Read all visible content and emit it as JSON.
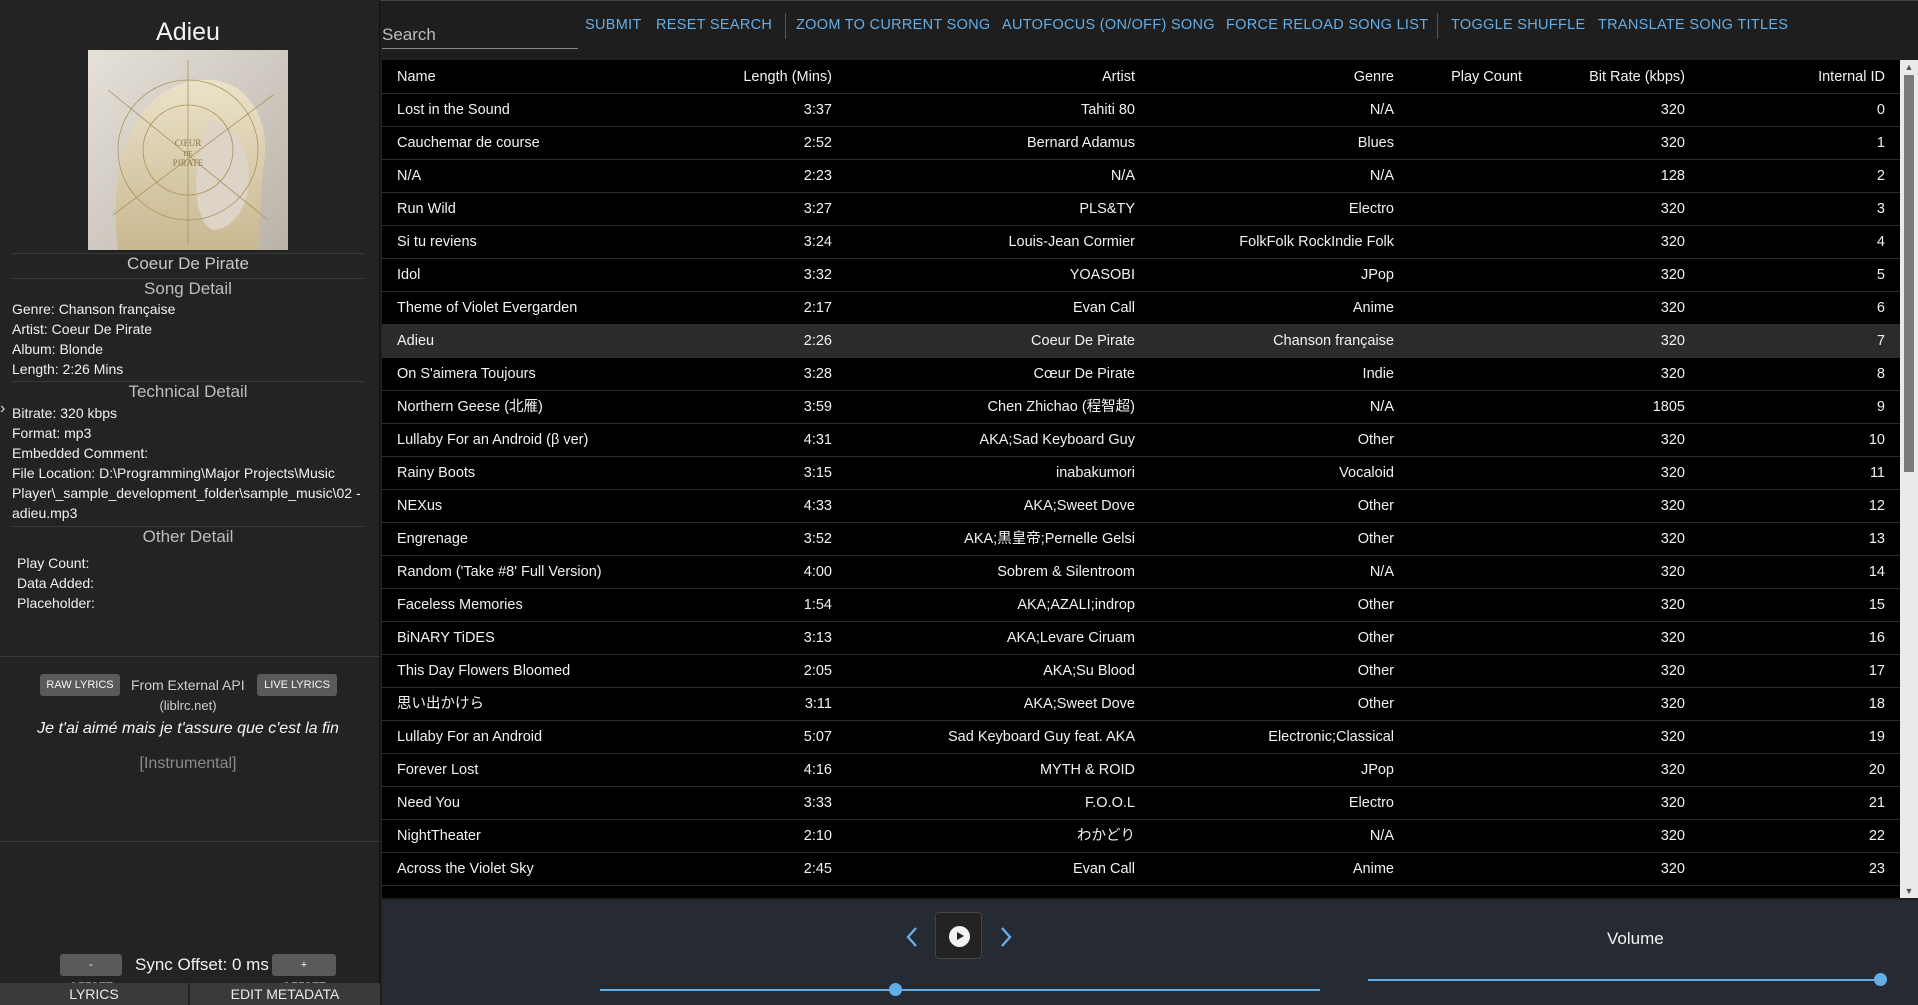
{
  "now_playing": {
    "title": "Adieu",
    "artist": "Coeur De Pirate",
    "cover_text": [
      "CŒUR",
      "DE",
      "PIRATE"
    ]
  },
  "song_detail": {
    "heading": "Song Detail",
    "genre": "Genre: Chanson française",
    "artist": "Artist: Coeur De Pirate",
    "album": "Album: Blonde",
    "length": "Length: 2:26 Mins"
  },
  "technical_detail": {
    "heading": "Technical Detail",
    "bitrate": "Bitrate: 320 kbps",
    "format": "Format: mp3",
    "comment": "Embedded Comment:",
    "file_location": "File Location: D:\\Programming\\Major Projects\\Music Player\\_sample_development_folder\\sample_music\\02 - adieu.mp3"
  },
  "other_detail": {
    "heading": "Other Detail",
    "play_count": "Play Count:",
    "date_added": "Data Added:",
    "placeholder": "Placeholder:"
  },
  "lyrics": {
    "raw_label": "RAW LYRICS",
    "live_label": "LIVE LYRICS",
    "source": "From External API",
    "source_detail": "(liblrc.net)",
    "current_line": "Je t'ai aimé mais je t'assure que c'est la fin",
    "next_line": "[Instrumental]",
    "minus_offset": "- OFFSET",
    "plus_offset": "+ OFFSET",
    "sync_offset": "Sync Offset: 0 ms"
  },
  "bottom_tabs": {
    "lyrics": "LYRICS",
    "edit_metadata": "EDIT METADATA"
  },
  "toolbar": {
    "search_placeholder": "Search",
    "submit": "SUBMIT",
    "reset_search": "RESET SEARCH",
    "zoom_to_current": "ZOOM TO CURRENT SONG",
    "autofocus": "AUTOFOCUS (ON/OFF) SONG",
    "force_reload": "FORCE RELOAD SONG LIST",
    "toggle_shuffle": "TOGGLE SHUFFLE",
    "translate_titles": "TRANSLATE SONG TITLES"
  },
  "table": {
    "columns": [
      "Name",
      "Length (Mins)",
      "Artist",
      "Genre",
      "Play Count",
      "Bit Rate (kbps)",
      "Internal ID"
    ],
    "active_row": 7,
    "rows": [
      [
        "Lost in the Sound",
        "3:37",
        "Tahiti 80",
        "N/A",
        "",
        "320",
        "0"
      ],
      [
        "Cauchemar de course",
        "2:52",
        "Bernard Adamus",
        "Blues",
        "",
        "320",
        "1"
      ],
      [
        "N/A",
        "2:23",
        "N/A",
        "N/A",
        "",
        "128",
        "2"
      ],
      [
        "Run Wild",
        "3:27",
        "PLS&TY",
        "Electro",
        "",
        "320",
        "3"
      ],
      [
        "Si tu reviens",
        "3:24",
        "Louis-Jean Cormier",
        "FolkFolk RockIndie Folk",
        "",
        "320",
        "4"
      ],
      [
        "Idol",
        "3:32",
        "YOASOBI",
        "JPop",
        "",
        "320",
        "5"
      ],
      [
        "Theme of Violet Evergarden",
        "2:17",
        "Evan Call",
        "Anime",
        "",
        "320",
        "6"
      ],
      [
        "Adieu",
        "2:26",
        "Coeur De Pirate",
        "Chanson française",
        "",
        "320",
        "7"
      ],
      [
        "On S'aimera Toujours",
        "3:28",
        "Cœur De Pirate",
        "Indie",
        "",
        "320",
        "8"
      ],
      [
        "Northern Geese (北雁)",
        "3:59",
        "Chen Zhichao (程智超)",
        "N/A",
        "",
        "1805",
        "9"
      ],
      [
        "Lullaby For an Android (β ver)",
        "4:31",
        "AKA;Sad Keyboard Guy",
        "Other",
        "",
        "320",
        "10"
      ],
      [
        "Rainy Boots",
        "3:15",
        "inabakumori",
        "Vocaloid",
        "",
        "320",
        "11"
      ],
      [
        "NEXus",
        "4:33",
        "AKA;Sweet Dove",
        "Other",
        "",
        "320",
        "12"
      ],
      [
        "Engrenage",
        "3:52",
        "AKA;黒皇帝;Pernelle Gelsi",
        "Other",
        "",
        "320",
        "13"
      ],
      [
        "Random ('Take #8' Full Version)",
        "4:00",
        "Sobrem & Silentroom",
        "N/A",
        "",
        "320",
        "14"
      ],
      [
        "Faceless Memories",
        "1:54",
        "AKA;AZALI;indrop",
        "Other",
        "",
        "320",
        "15"
      ],
      [
        "BiNARY TiDES",
        "3:13",
        "AKA;Levare Ciruam",
        "Other",
        "",
        "320",
        "16"
      ],
      [
        "This Day Flowers Bloomed",
        "2:05",
        "AKA;Su Blood",
        "Other",
        "",
        "320",
        "17"
      ],
      [
        "思い出かけら",
        "3:11",
        "AKA;Sweet Dove",
        "Other",
        "",
        "320",
        "18"
      ],
      [
        "Lullaby For an Android",
        "5:07",
        "Sad Keyboard Guy feat. AKA",
        "Electronic;Classical",
        "",
        "320",
        "19"
      ],
      [
        "Forever Lost",
        "4:16",
        "MYTH & ROID",
        "JPop",
        "",
        "320",
        "20"
      ],
      [
        "Need You",
        "3:33",
        "F.O.O.L",
        "Electro",
        "",
        "320",
        "21"
      ],
      [
        "NightTheater",
        "2:10",
        "わかどり",
        "N/A",
        "",
        "320",
        "22"
      ],
      [
        "Across the Violet Sky",
        "2:45",
        "Evan Call",
        "Anime",
        "",
        "320",
        "23"
      ]
    ]
  },
  "player": {
    "progress_fraction": 0.41,
    "volume_label": "Volume",
    "volume_fraction": 1.0,
    "accent": "#64aee8"
  }
}
